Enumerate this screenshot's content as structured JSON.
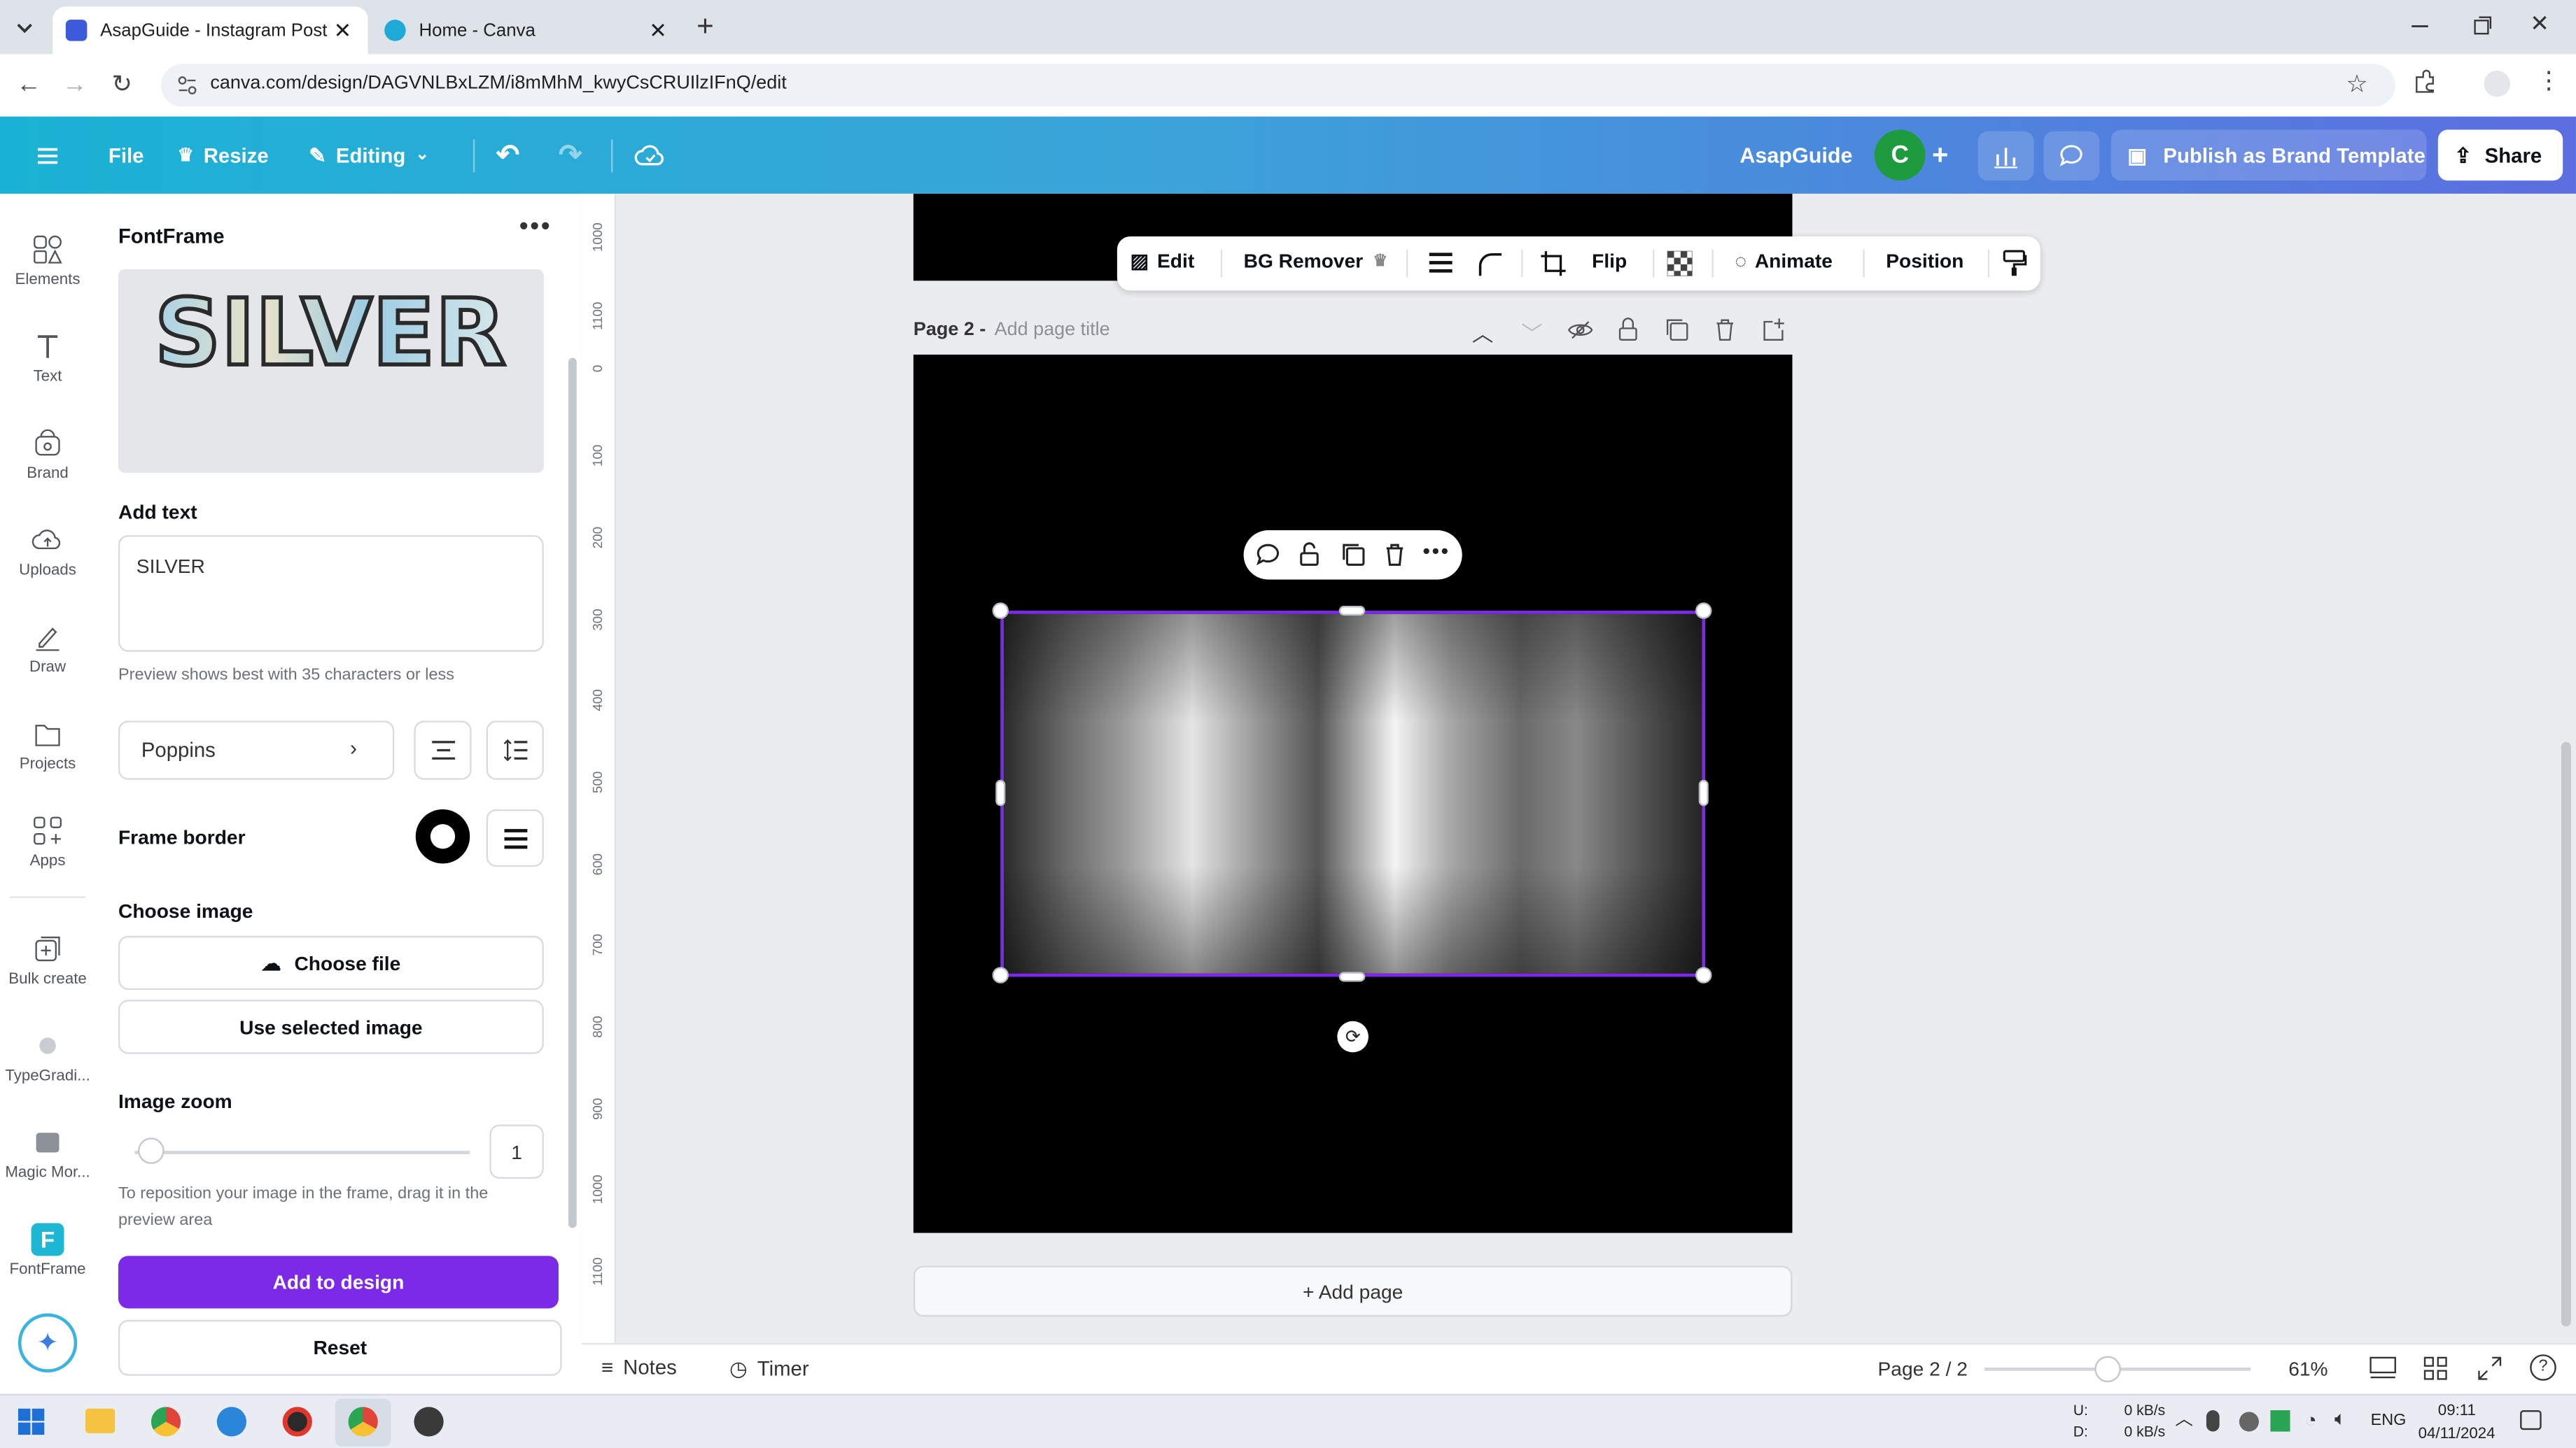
{
  "browser": {
    "tabs": [
      {
        "title": "AsapGuide - Instagram Post",
        "active": true
      },
      {
        "title": "Home - Canva",
        "active": false
      }
    ],
    "url": "canva.com/design/DAGVNLBxLZM/i8mMhM_kwyCsCRUIlzIFnQ/edit"
  },
  "header": {
    "file": "File",
    "resize": "Resize",
    "editing": "Editing",
    "team_name": "AsapGuide",
    "avatar_letter": "C",
    "publish": "Publish as Brand Template",
    "share": "Share",
    "gradient_start": "#1ab2d4",
    "gradient_end": "#5c6ee0"
  },
  "nav": {
    "items": [
      {
        "label": "Elements",
        "icon": "elements-icon"
      },
      {
        "label": "Text",
        "icon": "text-icon"
      },
      {
        "label": "Brand",
        "icon": "brand-icon"
      },
      {
        "label": "Uploads",
        "icon": "uploads-icon"
      },
      {
        "label": "Draw",
        "icon": "draw-icon"
      },
      {
        "label": "Projects",
        "icon": "projects-icon"
      },
      {
        "label": "Apps",
        "icon": "apps-icon"
      },
      {
        "label": "Bulk create",
        "icon": "bulk-create-icon"
      },
      {
        "label": "TypeGradi...",
        "icon": "typegradient-icon"
      },
      {
        "label": "Magic Mor...",
        "icon": "magic-morph-icon"
      },
      {
        "label": "FontFrame",
        "icon": "fontframe-icon"
      }
    ]
  },
  "panel": {
    "title": "FontFrame",
    "preview_text": "SILVER",
    "add_text_label": "Add text",
    "text_value": "SILVER",
    "text_hint": "Preview shows best with 35 characters or less",
    "font": "Poppins",
    "frame_border_label": "Frame border",
    "choose_image_label": "Choose image",
    "choose_file": "Choose file",
    "use_selected": "Use selected image",
    "image_zoom_label": "Image zoom",
    "zoom_value": "1",
    "reposition_hint": "To reposition your image in the frame, drag it in the preview area",
    "add_to_design": "Add to design",
    "reset": "Reset",
    "accent": "#7d2ae8"
  },
  "ruler": {
    "labels": [
      "1000",
      "1100",
      "0",
      "100",
      "200",
      "300",
      "400",
      "500",
      "600",
      "700",
      "800",
      "900",
      "1000",
      "1100"
    ]
  },
  "toolbar": {
    "edit": "Edit",
    "bg_remover": "BG Remover",
    "flip": "Flip",
    "animate": "Animate",
    "position": "Position"
  },
  "page": {
    "label": "Page 2 -",
    "title_placeholder": "Add page title",
    "add_page": "+ Add page"
  },
  "bottom": {
    "notes": "Notes",
    "timer": "Timer",
    "page_counter": "Page 2 / 2",
    "zoom": "61%",
    "zoom_fraction": 0.46
  },
  "taskbar": {
    "net_up_label": "U:",
    "net_down_label": "D:",
    "net_up": "0 kB/s",
    "net_down": "0 kB/s",
    "lang": "ENG",
    "time": "09:11",
    "date": "04/11/2024"
  }
}
